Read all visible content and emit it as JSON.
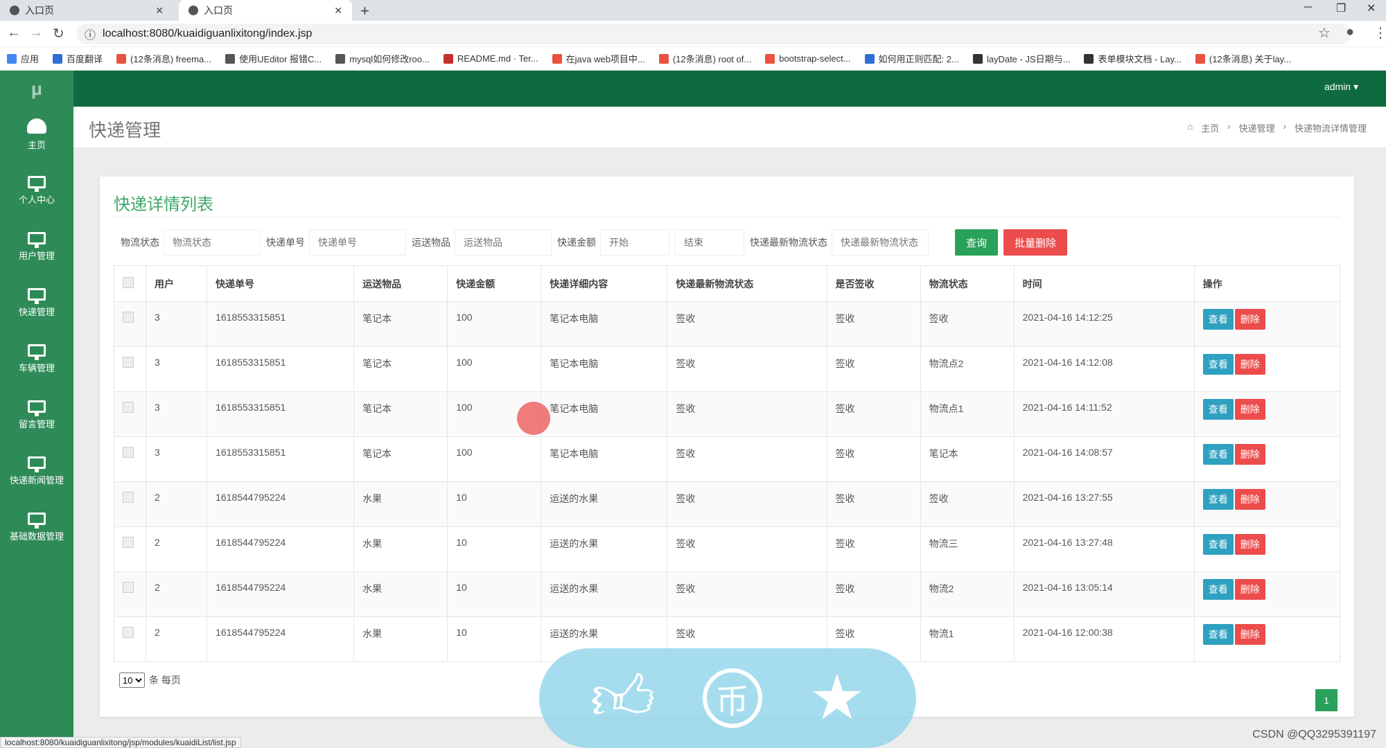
{
  "browser": {
    "tabs": [
      {
        "title": "入口页",
        "active": false
      },
      {
        "title": "入口页",
        "active": true
      }
    ],
    "url": "localhost:8080/kuaidiguanlixitong/index.jsp",
    "bookmarks": [
      {
        "label": "应用",
        "color": "#4285f4"
      },
      {
        "label": "百度翻译",
        "color": "#2f6fd1"
      },
      {
        "label": "(12条消息) freema...",
        "color": "#e8523e"
      },
      {
        "label": "使用UEditor 报错C...",
        "color": "#555555"
      },
      {
        "label": "mysql如何修改roo...",
        "color": "#555555"
      },
      {
        "label": "README.md · Ter...",
        "color": "#c7302c"
      },
      {
        "label": "在java web项目中...",
        "color": "#e8523e"
      },
      {
        "label": "(12条消息) root of...",
        "color": "#e8523e"
      },
      {
        "label": "bootstrap-select...",
        "color": "#e8523e"
      },
      {
        "label": "如何用正则匹配: 2...",
        "color": "#2f6fd1"
      },
      {
        "label": "layDate - JS日期与...",
        "color": "#333333"
      },
      {
        "label": "表单模块文档 - Lay...",
        "color": "#333333"
      },
      {
        "label": "(12条消息) 关于lay...",
        "color": "#e8523e"
      }
    ],
    "status_url": "localhost:8080/kuaidiguanlixitong/jsp/modules/kuaidiList/list.jsp"
  },
  "app": {
    "logo": "μ",
    "user": "admin ▾",
    "sidebar": [
      {
        "label": "主页",
        "icon": "dashboard-icon"
      },
      {
        "label": "个人中心",
        "icon": "monitor-icon"
      },
      {
        "label": "用户管理",
        "icon": "monitor-icon"
      },
      {
        "label": "快递管理",
        "icon": "monitor-icon"
      },
      {
        "label": "车辆管理",
        "icon": "monitor-icon"
      },
      {
        "label": "留言管理",
        "icon": "monitor-icon"
      },
      {
        "label": "快递新闻管理",
        "icon": "monitor-icon"
      },
      {
        "label": "基础数据管理",
        "icon": "monitor-icon"
      }
    ],
    "page_title": "快递管理",
    "breadcrumb": [
      "主页",
      "快递管理",
      "快递物流详情管理"
    ],
    "card_title": "快递详情列表",
    "filters": {
      "status_label": "物流状态",
      "status_placeholder": "物流状态",
      "number_label": "快递单号",
      "number_placeholder": "快递单号",
      "item_label": "运送物品",
      "item_placeholder": "运送物品",
      "amount_label": "快递金额",
      "amount_start": "开始",
      "amount_end": "结束",
      "latest_label": "快递最新物流状态",
      "latest_placeholder": "快递最新物流状态",
      "search_btn": "查询",
      "batch_delete_btn": "批量删除"
    },
    "columns": [
      "用户",
      "快递单号",
      "运送物品",
      "快递金额",
      "快递详细内容",
      "快递最新物流状态",
      "是否签收",
      "物流状态",
      "时间",
      "操作"
    ],
    "rows": [
      [
        "3",
        "1618553315851",
        "笔记本",
        "100",
        "笔记本电脑",
        "签收",
        "签收",
        "签收",
        "2021-04-16 14:12:25"
      ],
      [
        "3",
        "1618553315851",
        "笔记本",
        "100",
        "笔记本电脑",
        "签收",
        "签收",
        "物流点2",
        "2021-04-16 14:12:08"
      ],
      [
        "3",
        "1618553315851",
        "笔记本",
        "100",
        "笔记本电脑",
        "签收",
        "签收",
        "物流点1",
        "2021-04-16 14:11:52"
      ],
      [
        "3",
        "1618553315851",
        "笔记本",
        "100",
        "笔记本电脑",
        "签收",
        "签收",
        "笔记本",
        "2021-04-16 14:08:57"
      ],
      [
        "2",
        "1618544795224",
        "水果",
        "10",
        "运送的水果",
        "签收",
        "签收",
        "签收",
        "2021-04-16 13:27:55"
      ],
      [
        "2",
        "1618544795224",
        "水果",
        "10",
        "运送的水果",
        "签收",
        "签收",
        "物流三",
        "2021-04-16 13:27:48"
      ],
      [
        "2",
        "1618544795224",
        "水果",
        "10",
        "运送的水果",
        "签收",
        "签收",
        "物流2",
        "2021-04-16 13:05:14"
      ],
      [
        "2",
        "1618544795224",
        "水果",
        "10",
        "运送的水果",
        "签收",
        "签收",
        "物流1",
        "2021-04-16 12:00:38"
      ]
    ],
    "row_actions": {
      "view": "查看",
      "delete": "删除"
    },
    "page_size": "10",
    "page_size_suffix": "条 每页",
    "current_page": "1"
  },
  "watermark": "CSDN @QQ3295391197",
  "colors": {
    "sidebar": "#2e8b57",
    "topbar": "#0e6b3f",
    "accent": "#3ca86a",
    "danger": "#ec4c4c",
    "info": "#2ea0c0"
  }
}
